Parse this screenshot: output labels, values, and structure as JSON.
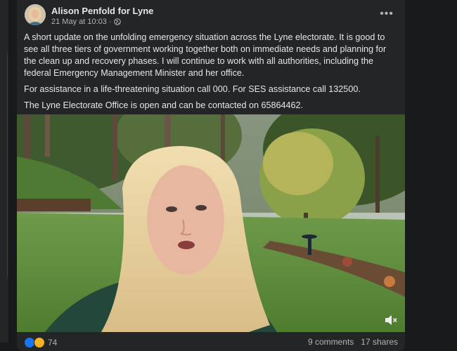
{
  "post": {
    "author": "Alison Penfold for Lyne",
    "date": "21 May at 10:03",
    "separator": "·",
    "privacy_icon": "globe-icon",
    "more_icon": "more-options-icon",
    "paragraphs": [
      "A short update on the unfolding emergency situation across the Lyne electorate. It is good to see all three tiers of government working together both on immediate needs and planning for the clean up and recovery phases. I will continue to work with all authorities, including the federal Emergency Management Minister and her office.",
      "For assistance in a life-threatening situation call 000. For SES assistance call 132500.",
      "The Lyne Electorate Office is open and can be contacted on 65864462."
    ]
  },
  "video": {
    "mute_icon": "speaker-icon"
  },
  "footer": {
    "reaction_count": "74",
    "comments": "9 comments",
    "shares": "17 shares"
  },
  "colors": {
    "background": "#18191a",
    "card": "#242526",
    "text": "#e4e6eb",
    "secondary_text": "#b0b3b8",
    "like_blue": "#1877f2"
  }
}
